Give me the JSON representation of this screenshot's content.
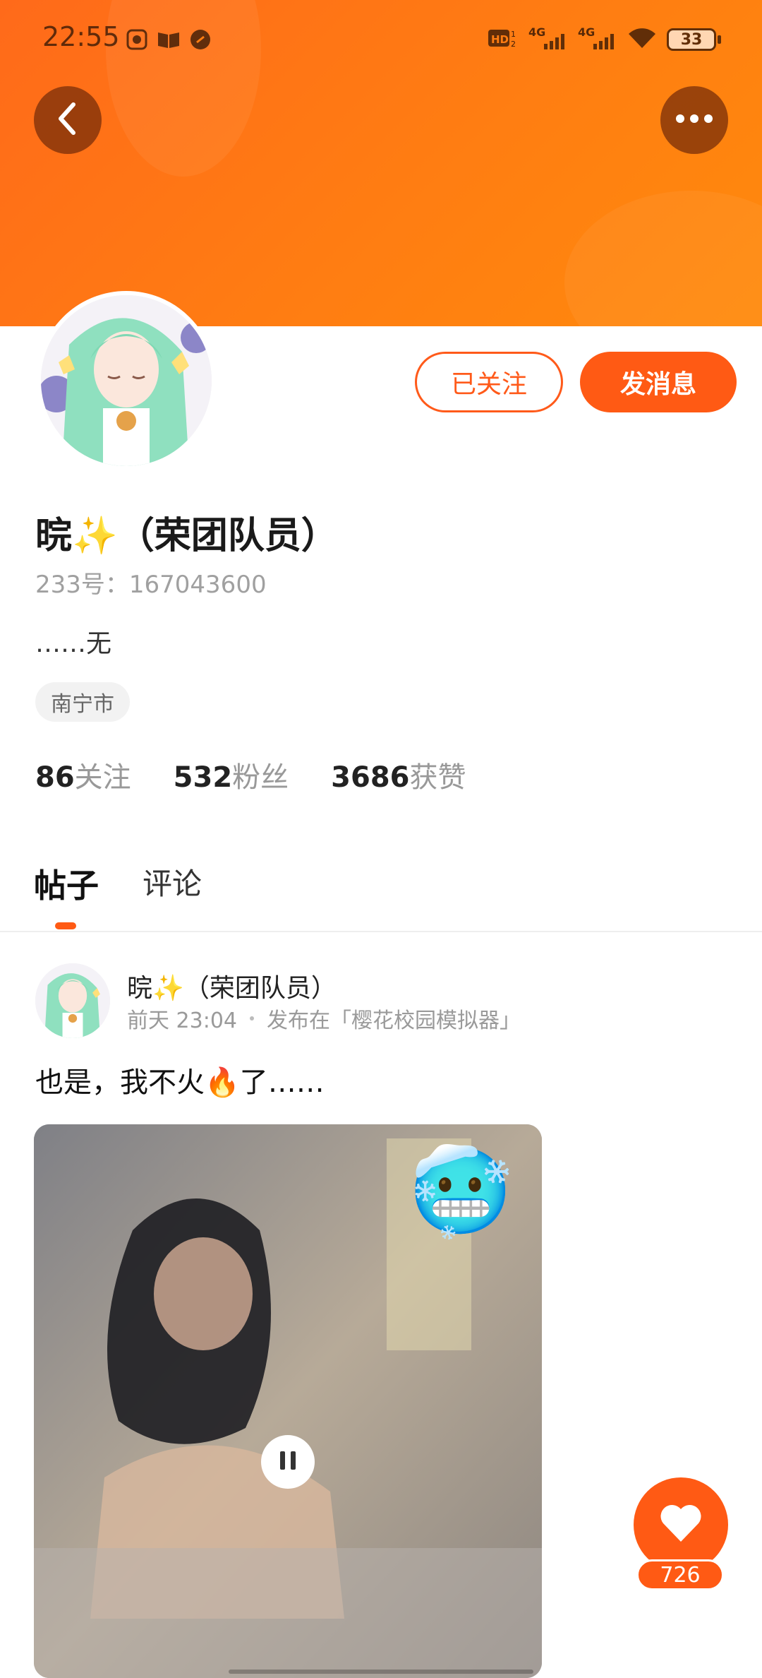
{
  "status_bar": {
    "time": "22:55",
    "network1": "4G",
    "network2": "4G",
    "battery": "33"
  },
  "profile": {
    "name": "晥✨（荣团队员）",
    "uid": "233号：167043600",
    "bio": "……无",
    "location": "南宁市",
    "follow_button": "已关注",
    "message_button": "发消息"
  },
  "stats": [
    {
      "num": "86",
      "label": "关注"
    },
    {
      "num": "532",
      "label": "粉丝"
    },
    {
      "num": "3686",
      "label": "获赞"
    }
  ],
  "tabs": [
    {
      "label": "帖子",
      "active": true
    },
    {
      "label": "评论",
      "active": false
    }
  ],
  "post": {
    "author": "晥✨（荣团队员）",
    "time": "前天 23:04",
    "channel": "发布在「樱花校园模拟器」",
    "text": "也是，我不火🔥了……",
    "sticker": "🥶"
  },
  "like": {
    "count": "726"
  },
  "colors": {
    "accent": "#ff5a14",
    "banner_start": "#ff6a1a",
    "banner_end": "#ff8a0c"
  },
  "icons": [
    "back-icon",
    "more-icon",
    "heart-icon",
    "pause-icon",
    "wifi-icon",
    "battery-icon"
  ]
}
